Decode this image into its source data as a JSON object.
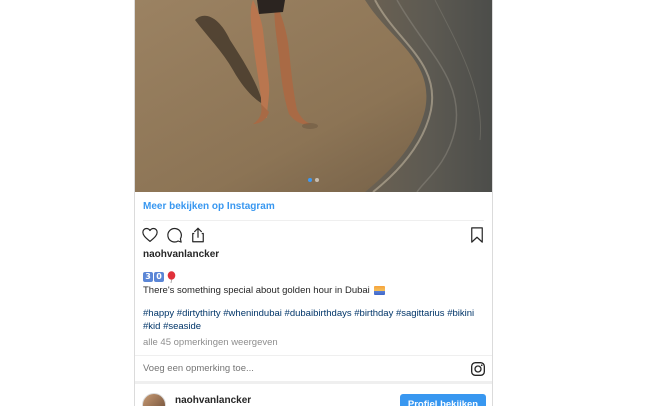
{
  "post": {
    "more_link": "Meer bekijken op Instagram",
    "username": "naohvanlancker",
    "caption_numbers": [
      "3",
      "0"
    ],
    "caption_text": "There's something special about golden hour in Dubai",
    "hashtags": "#happy #dirtythirty #whenindubai #dubaibirthdays #birthday #sagittarius #bikini #kid #seaside",
    "comments_link": "alle 45 opmerkingen weergeven",
    "comment_placeholder": "Voeg een opmerking toe...",
    "carousel_active_index": 0,
    "carousel_count": 2
  },
  "footer": {
    "username": "naohvanlancker",
    "profile_button": "Profiel bekijken"
  },
  "colors": {
    "link": "#3897f0",
    "hashtag": "#003569",
    "muted": "#8e8e8e",
    "text": "#262626"
  },
  "icons": {
    "like": "heart-outline",
    "comment": "speech-bubble-outline",
    "share": "share-upload-outline",
    "save": "bookmark-outline",
    "instagram": "instagram-logo",
    "balloon": "red-balloon-emoji",
    "sunset": "sunset-emoji"
  }
}
